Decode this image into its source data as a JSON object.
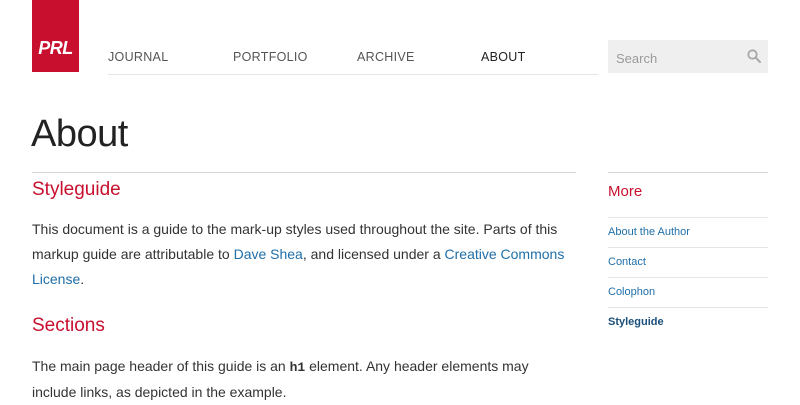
{
  "logo": {
    "text": "PRL"
  },
  "nav": {
    "items": [
      {
        "label": "JOURNAL"
      },
      {
        "label": "PORTFOLIO"
      },
      {
        "label": "ARCHIVE"
      },
      {
        "label": "ABOUT"
      }
    ],
    "active": "ABOUT"
  },
  "search": {
    "placeholder": "Search",
    "icon": "search-icon"
  },
  "page": {
    "title": "About"
  },
  "sections": [
    {
      "heading": "Styleguide",
      "text_1": "This document is a guide to the mark-up styles used throughout the site. Parts of this markup guide are attributable to ",
      "link_1": "Dave Shea",
      "text_2": ", and licensed under a ",
      "link_2": "Creative Commons License",
      "text_3": "."
    },
    {
      "heading": "Sections",
      "text_1": "The main page header of this guide is an ",
      "code": "h1",
      "text_2": " element. Any header elements may include links, as depicted in the example."
    }
  ],
  "sidebar": {
    "title": "More",
    "items": [
      {
        "label": "About the Author"
      },
      {
        "label": "Contact"
      },
      {
        "label": "Colophon"
      },
      {
        "label": "Styleguide"
      }
    ],
    "current": "Styleguide"
  },
  "colors": {
    "brand": "#c8102e",
    "link": "#1f6fa8"
  }
}
